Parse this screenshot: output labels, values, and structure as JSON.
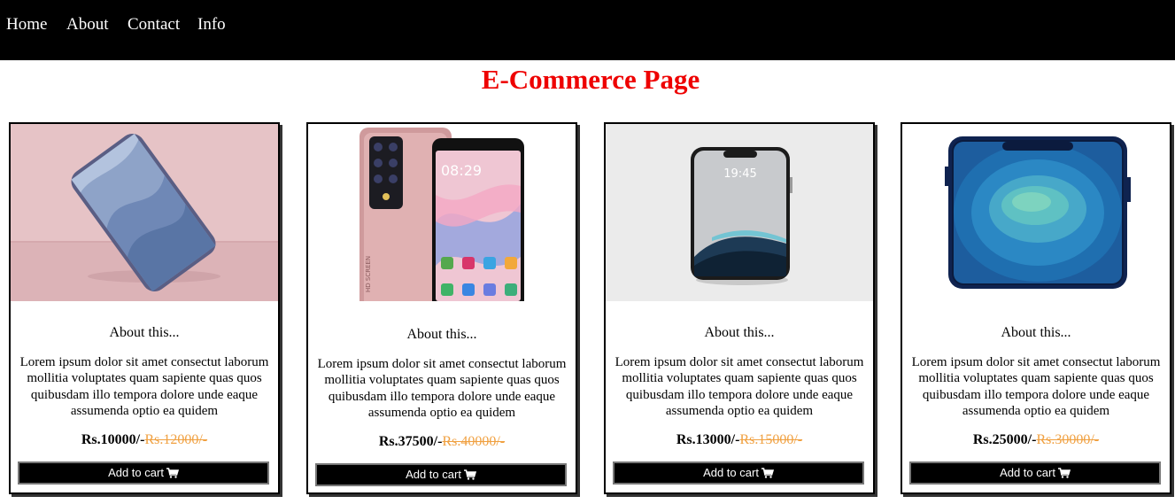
{
  "nav": {
    "items": [
      {
        "label": "Home"
      },
      {
        "label": "About"
      },
      {
        "label": "Contact"
      },
      {
        "label": "Info"
      }
    ]
  },
  "page": {
    "title": "E-Commerce Page"
  },
  "products": [
    {
      "about": "About this...",
      "description": "Lorem ipsum dolor sit amet consectut laborum mollitia voluptates quam sapiente quas quos quibusdam illo tempora dolore unde eaque assumenda optio ea quidem",
      "price": "Rs.10000/-",
      "old_price": "Rs.12000/-",
      "button": "Add to cart",
      "image_icon": "phone-image"
    },
    {
      "about": "About this...",
      "description": "Lorem ipsum dolor sit amet consectut laborum mollitia voluptates quam sapiente quas quos quibusdam illo tempora dolore unde eaque assumenda optio ea quidem",
      "price": "Rs.37500/-",
      "old_price": "Rs.40000/-",
      "button": "Add to cart",
      "image_icon": "phone-image"
    },
    {
      "about": "About this...",
      "description": "Lorem ipsum dolor sit amet consectut laborum mollitia voluptates quam sapiente quas quos quibusdam illo tempora dolore unde eaque assumenda optio ea quidem",
      "price": "Rs.13000/-",
      "old_price": "Rs.15000/-",
      "button": "Add to cart",
      "image_icon": "phone-image"
    },
    {
      "about": "About this...",
      "description": "Lorem ipsum dolor sit amet consectut laborum mollitia voluptates quam sapiente quas quos quibusdam illo tempora dolore unde eaque assumenda optio ea quidem",
      "price": "Rs.25000/-",
      "old_price": "Rs.30000/-",
      "button": "Add to cart",
      "image_icon": "phone-image"
    }
  ],
  "phone_screens": {
    "clock_2": "08:29",
    "clock_3": "19:45",
    "hd_label": "HD SCREEN"
  },
  "colors": {
    "nav_bg": "#000000",
    "title": "#ee0000",
    "old_price": "#f0a040",
    "button_bg": "#000000"
  }
}
